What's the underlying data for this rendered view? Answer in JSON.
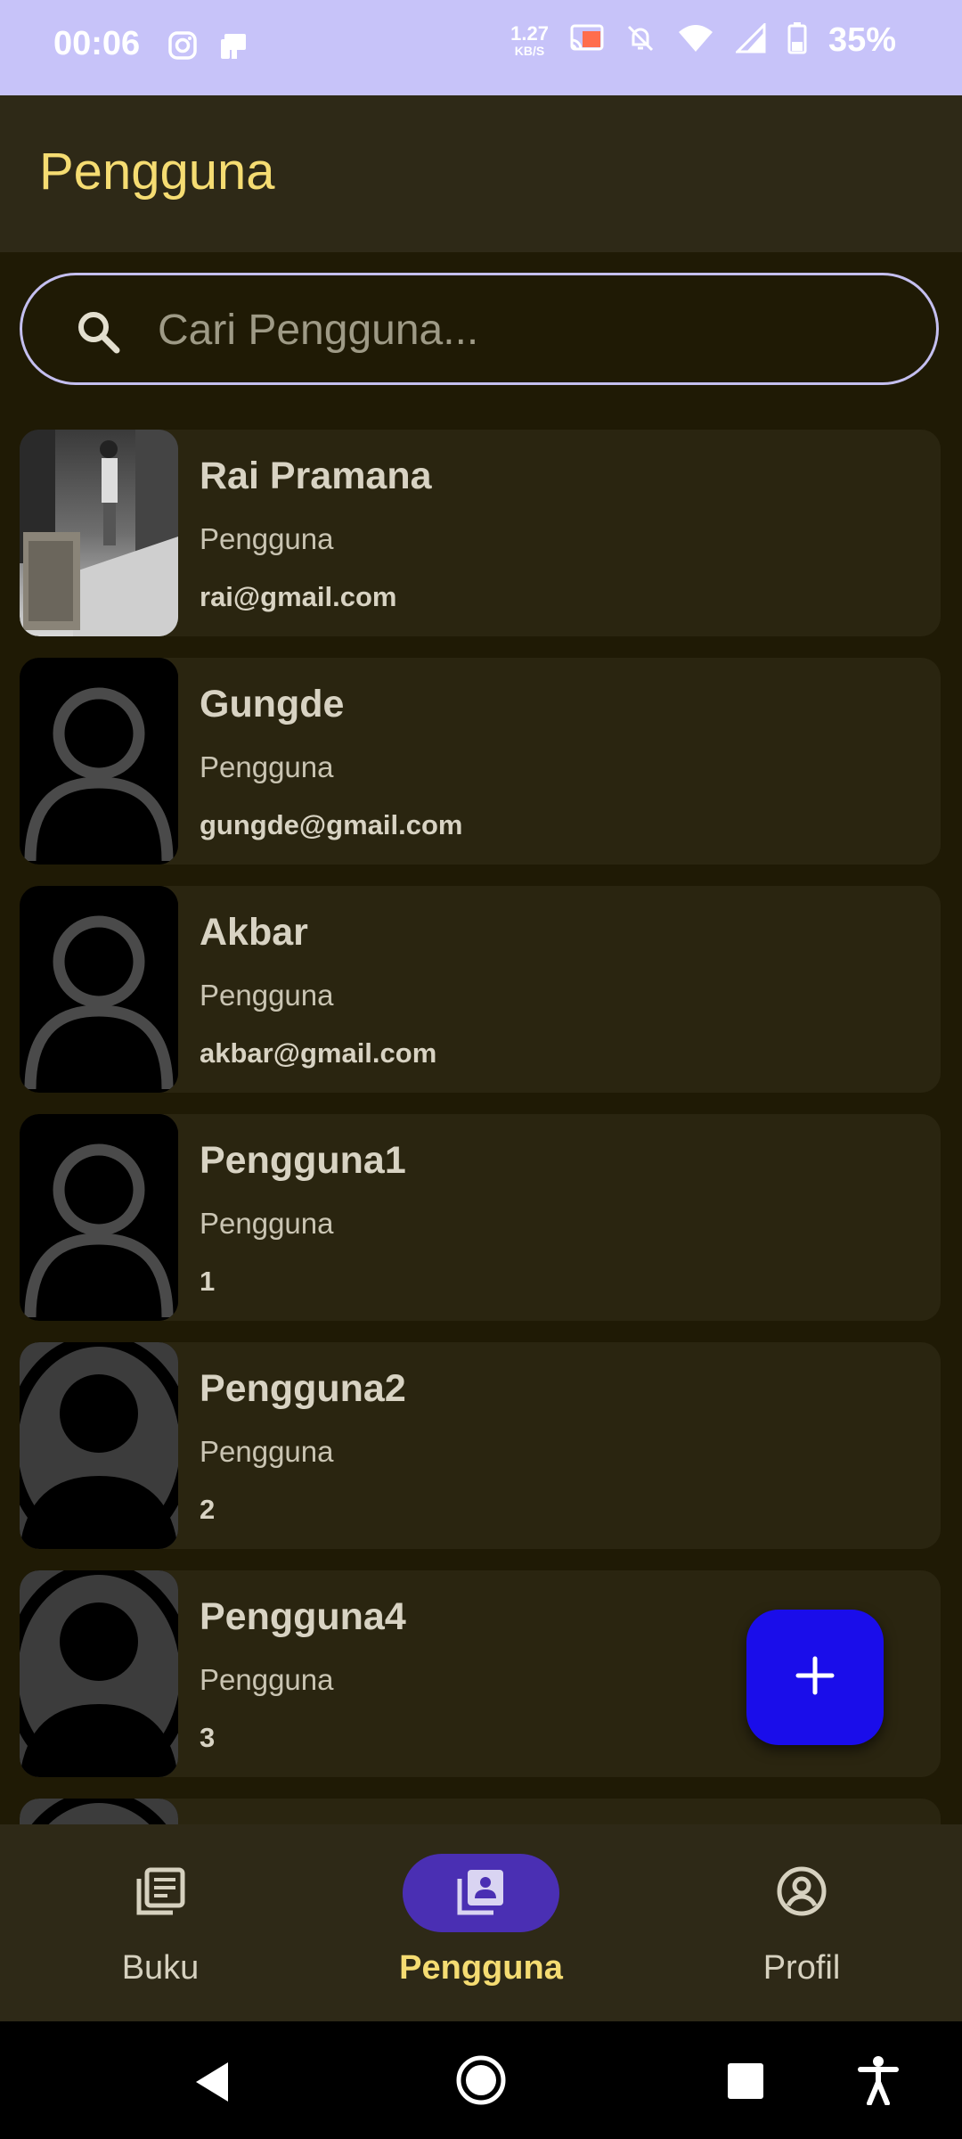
{
  "status_bar": {
    "time": "00:06",
    "net_speed_value": "1.27",
    "net_speed_unit": "KB/S",
    "battery_percent": "35%",
    "icons": [
      "instagram-icon",
      "notification-app-icon",
      "cast-icon",
      "bell-off-icon",
      "wifi-icon",
      "signal-icon",
      "battery-icon"
    ]
  },
  "app_bar": {
    "title": "Pengguna"
  },
  "search": {
    "placeholder": "Cari Pengguna..."
  },
  "users": [
    {
      "name": "Rai Pramana",
      "role": "Pengguna",
      "email": "rai@gmail.com",
      "avatar": "photo"
    },
    {
      "name": "Gungde",
      "role": "Pengguna",
      "email": "gungde@gmail.com",
      "avatar": "outline"
    },
    {
      "name": "Akbar",
      "role": "Pengguna",
      "email": "akbar@gmail.com",
      "avatar": "outline"
    },
    {
      "name": "Pengguna1",
      "role": "Pengguna",
      "email": "1",
      "avatar": "outline"
    },
    {
      "name": "Pengguna2",
      "role": "Pengguna",
      "email": "2",
      "avatar": "filled"
    },
    {
      "name": "Pengguna4",
      "role": "Pengguna",
      "email": "3",
      "avatar": "filled"
    },
    {
      "name": "",
      "role": "",
      "email": "",
      "avatar": "filled"
    }
  ],
  "fab": {
    "icon": "plus-icon"
  },
  "bottom_nav": {
    "items": [
      {
        "label": "Buku",
        "icon": "book-list-icon",
        "active": false
      },
      {
        "label": "Pengguna",
        "icon": "users-icon",
        "active": true
      },
      {
        "label": "Profil",
        "icon": "account-circle-icon",
        "active": false
      }
    ]
  },
  "system_nav": {
    "icons": [
      "back-icon",
      "home-icon",
      "recents-icon",
      "accessibility-icon"
    ]
  },
  "colors": {
    "background": "#1f1a05",
    "app_bar": "#2e2917",
    "status_bar": "#c7c3f9",
    "accent_title": "#f5dc72",
    "card": "#2a2510",
    "fab": "#1a0dea",
    "nav_pill": "#4a2fb3"
  }
}
